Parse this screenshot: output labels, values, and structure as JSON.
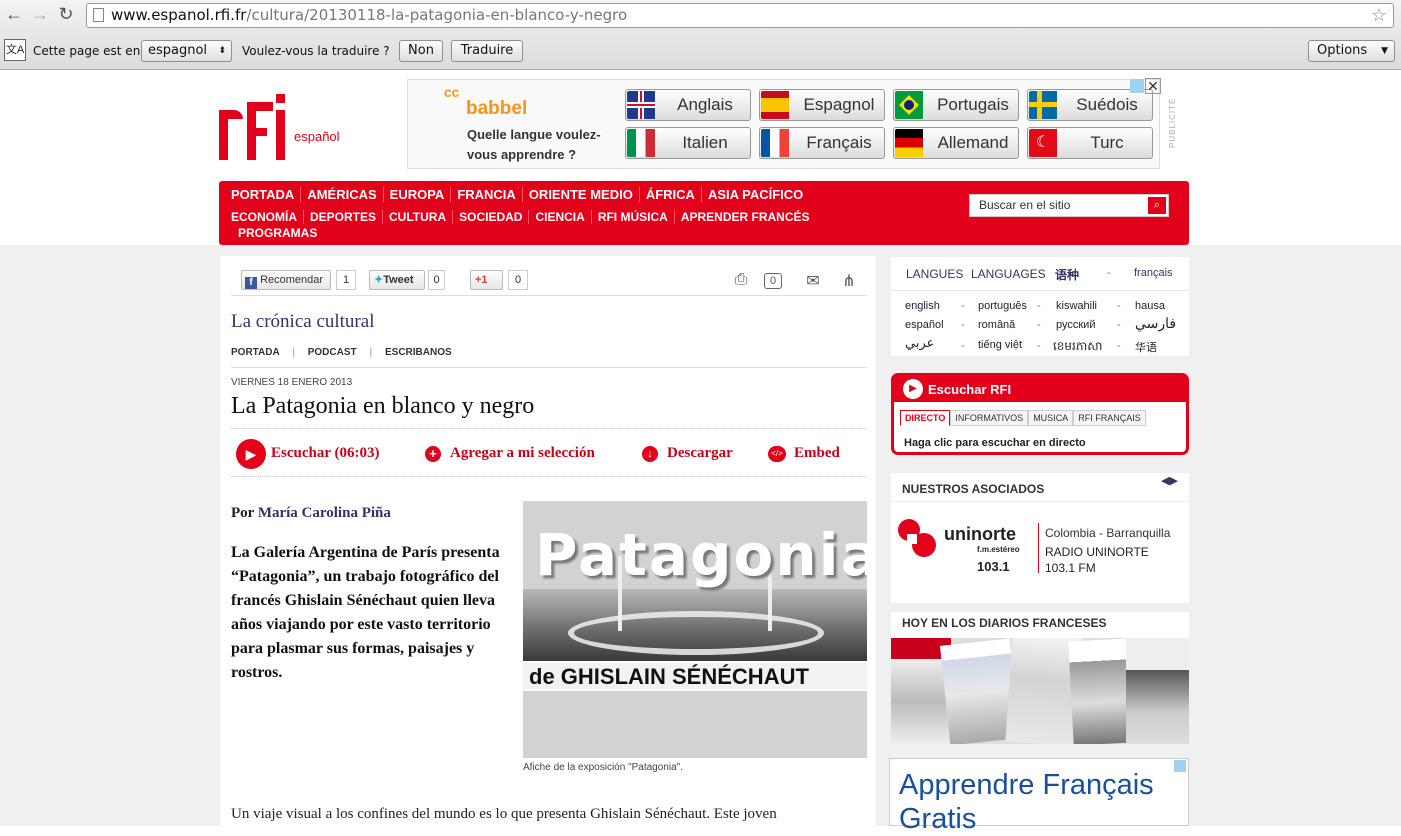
{
  "browser": {
    "url_host": "www.espanol.rfi.fr",
    "url_path": "/cultura/20130118-la-patagonia-en-blanco-y-negro",
    "translate": {
      "prefix": "Cette page est en",
      "language": "espagnol",
      "question": "Voulez-vous la traduire ?",
      "no": "Non",
      "yes": "Traduire",
      "options": "Options"
    }
  },
  "header": {
    "logo_sub": "español"
  },
  "ad": {
    "brand": "babbel",
    "question": "Quelle langue voulez-vous apprendre ?",
    "label": "PUBLICITÉ",
    "langs": [
      "Anglais",
      "Espagnol",
      "Portugais",
      "Suédois",
      "Italien",
      "Français",
      "Allemand",
      "Turc"
    ]
  },
  "nav": {
    "row1": [
      "PORTADA",
      "AMÉRICAS",
      "EUROPA",
      "FRANCIA",
      "ORIENTE MEDIO",
      "ÁFRICA",
      "ASIA PACÍFICO"
    ],
    "row2": [
      "ECONOMÍA",
      "DEPORTES",
      "CULTURA",
      "SOCIEDAD",
      "CIENCIA",
      "RFI MÚSICA",
      "APRENDER FRANCÉS"
    ],
    "row3": [
      "PROGRAMAS"
    ],
    "search": "Buscar en el sitio"
  },
  "social": {
    "fb": "Recomendar",
    "fb_count": "1",
    "tw": "Tweet",
    "tw_count": "0",
    "gp": "+1",
    "gp_count": "0",
    "comments": "0"
  },
  "section": {
    "title": "La crónica cultural",
    "links": [
      "PORTADA",
      "PODCAST",
      "ESCRIBANOS"
    ]
  },
  "article": {
    "date": "VIERNES 18 ENERO 2013",
    "title": "La Patagonia en blanco y negro",
    "actions": {
      "listen": "Escuchar (06:03)",
      "add": "Agregar a mi selección",
      "download": "Descargar",
      "embed": "Embed"
    },
    "by": "Por",
    "author": "María Carolina Piña",
    "lead": "La Galería Argentina de París presenta “Patagonia”, un trabajo fotográfico del francés Ghislain Sénéchaut quien lleva años viajando por este vasto territorio para plasmar sus formas, paisajes y rostros.",
    "image_title": "Patagonia",
    "image_sub": "de GHISLAIN SÉNÉCHAUT",
    "caption": "Afiche de la exposición \"Patagonia\".",
    "body": "Un viaje visual a los confines del mundo es lo que presenta Ghislain Sénéchaut. Este joven"
  },
  "sidebar": {
    "langues": {
      "h1": "LANGUES",
      "h2": "LANGUAGES",
      "h3": "语种",
      "sep": "-",
      "h4": "français",
      "items": [
        "english",
        "português",
        "kiswahili",
        "hausa",
        "español",
        "română",
        "русский",
        "فارسي",
        "عربي",
        "tiếng việt",
        "ខេមរភាសា",
        "华语"
      ]
    },
    "listen": {
      "title": "Escuchar RFI",
      "tabs": [
        "DIRECTO",
        "INFORMATIVOS",
        "MUSICA",
        "RFI FRANÇAIS"
      ],
      "text": "Haga clic para escuchar en directo"
    },
    "partners": {
      "title": "NUESTROS ASOCIADOS",
      "logo": "uninorte",
      "logo_sub": "f.m.estéreo",
      "freq": "103.1",
      "place": "Colombia - Barranquilla",
      "name": "RADIO UNINORTE",
      "fm": "103.1 FM"
    },
    "press": {
      "title": "HOY EN LOS DIARIOS FRANCESES"
    },
    "promo": {
      "line1": "Apprendre Français",
      "line2": "Gratis"
    }
  },
  "colors": {
    "rfi_red": "#e2001a",
    "link_blue": "#333366"
  }
}
